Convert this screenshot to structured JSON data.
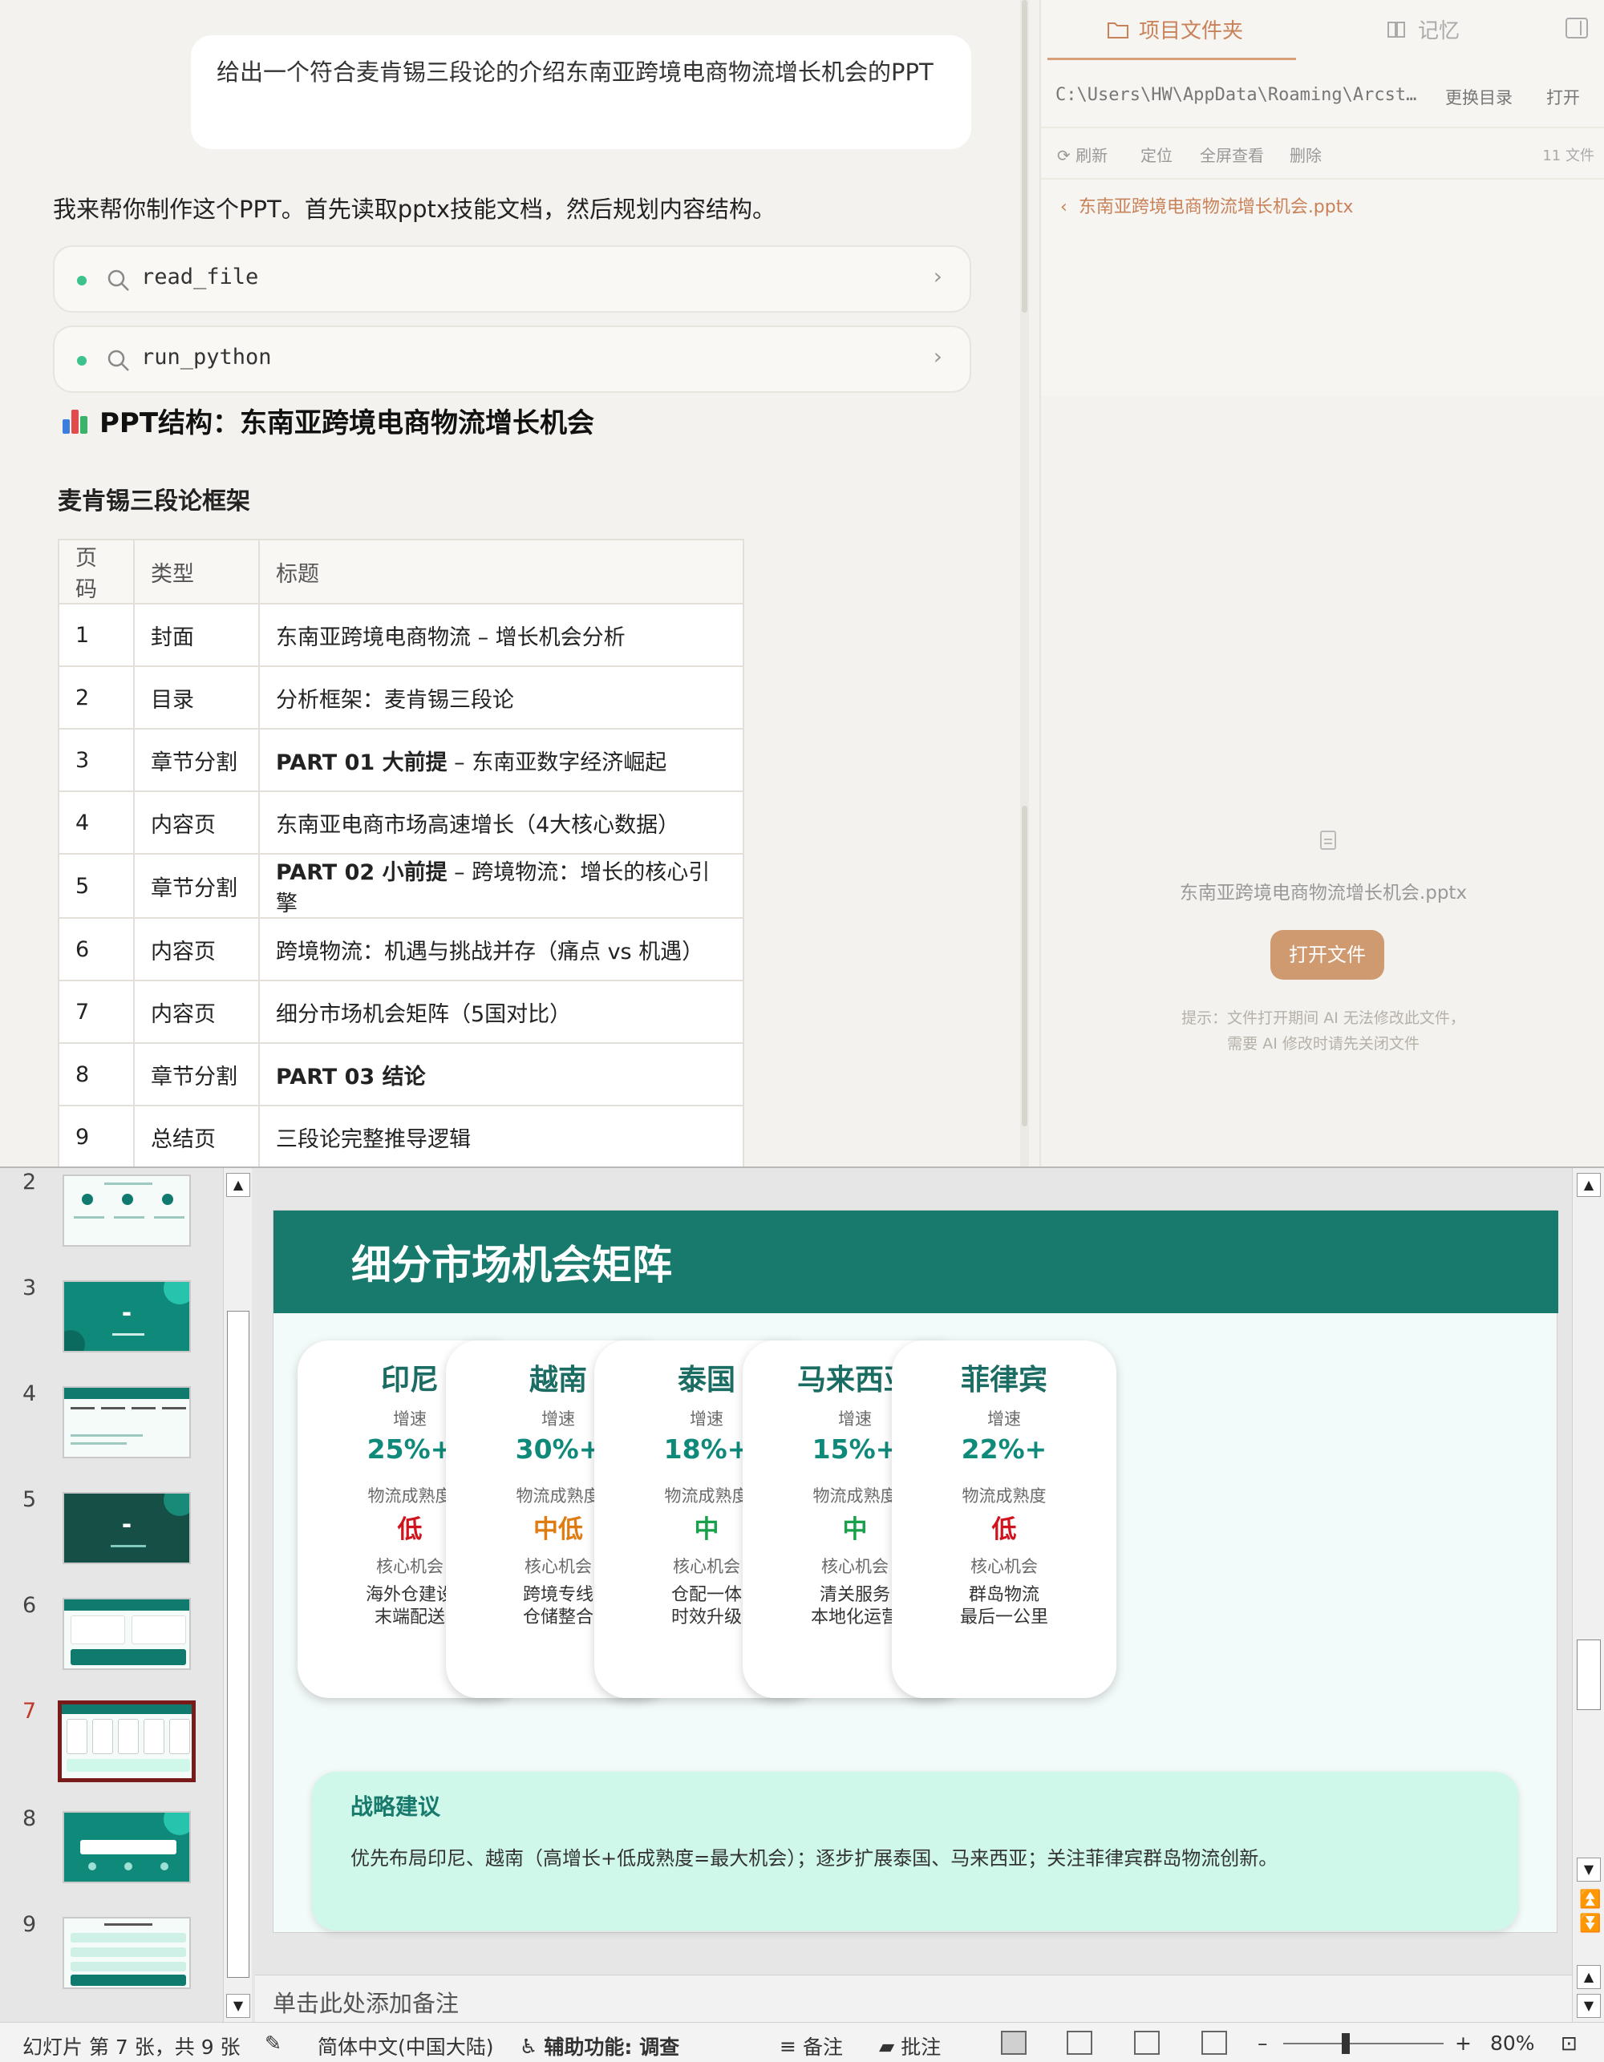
{
  "chat": {
    "user_message": "给出一个符合麦肯锡三段论的介绍东南亚跨境电商物流增长机会的PPT",
    "assistant_intro": "我来帮你制作这个PPT。首先读取pptx技能文档，然后规划内容结构。",
    "tool_calls": [
      {
        "name": "read_file",
        "status_color": "#3cc28a"
      },
      {
        "name": "run_python",
        "status_color": "#3cc28a"
      }
    ],
    "structure_heading": "PPT结构：东南亚跨境电商物流增长机会",
    "framework_heading": "麦肯锡三段论框架",
    "table": {
      "headers": [
        "页码",
        "类型",
        "标题"
      ],
      "rows": [
        {
          "page": "1",
          "type": "封面",
          "bold": "",
          "title": "东南亚跨境电商物流 – 增长机会分析"
        },
        {
          "page": "2",
          "type": "目录",
          "bold": "",
          "title": "分析框架：麦肯锡三段论"
        },
        {
          "page": "3",
          "type": "章节分割",
          "bold": "PART 01 大前提",
          "title": " – 东南亚数字经济崛起"
        },
        {
          "page": "4",
          "type": "内容页",
          "bold": "",
          "title": "东南亚电商市场高速增长（4大核心数据）"
        },
        {
          "page": "5",
          "type": "章节分割",
          "bold": "PART 02 小前提",
          "title": " – 跨境物流：增长的核心引擎"
        },
        {
          "page": "6",
          "type": "内容页",
          "bold": "",
          "title": "跨境物流：机遇与挑战并存（痛点 vs 机遇）"
        },
        {
          "page": "7",
          "type": "内容页",
          "bold": "",
          "title": "细分市场机会矩阵（5国对比）"
        },
        {
          "page": "8",
          "type": "章节分割",
          "bold": "PART 03 结论",
          "title": ""
        },
        {
          "page": "9",
          "type": "总结页",
          "bold": "",
          "title": "三段论完整推导逻辑"
        }
      ]
    }
  },
  "file_panel": {
    "tab_project": "项目文件夹",
    "tab_memory": "记忆",
    "path": "C:\\Users\\HW\\AppData\\Roaming\\Arcst…",
    "change_dir": "更换目录",
    "open": "打开",
    "actions": [
      "刷新",
      "定位",
      "全屏查看",
      "删除"
    ],
    "file_count": "11 文件",
    "breadcrumb": "东南亚跨境电商物流增长机会.pptx",
    "preview_filename": "东南亚跨境电商物流增长机会.pptx",
    "open_file_button": "打开文件",
    "hint_line1": "提示：文件打开期间 AI 无法修改此文件，",
    "hint_line2": "需要 AI 修改时请先关闭文件",
    "accent_color": "#c8825a"
  },
  "ppt": {
    "thumbnails": [
      {
        "num": "2"
      },
      {
        "num": "3"
      },
      {
        "num": "4"
      },
      {
        "num": "5"
      },
      {
        "num": "6"
      },
      {
        "num": "7",
        "selected": true
      },
      {
        "num": "8"
      },
      {
        "num": "9"
      }
    ],
    "slide": {
      "title": "细分市场机会矩阵",
      "growth_label": "增速",
      "maturity_label": "物流成熟度",
      "opportunity_label": "核心机会",
      "cards": [
        {
          "country": "印尼",
          "growth": "25%+",
          "maturity": "低",
          "maturity_color": "#d0141e",
          "opp1": "海外仓建设",
          "opp2": "末端配送"
        },
        {
          "country": "越南",
          "growth": "30%+",
          "maturity": "中低",
          "maturity_color": "#e07b10",
          "opp1": "跨境专线",
          "opp2": "仓储整合"
        },
        {
          "country": "泰国",
          "growth": "18%+",
          "maturity": "中",
          "maturity_color": "#18a14a",
          "opp1": "仓配一体",
          "opp2": "时效升级"
        },
        {
          "country": "马来西亚",
          "growth": "15%+",
          "maturity": "中",
          "maturity_color": "#18a14a",
          "opp1": "清关服务",
          "opp2": "本地化运营"
        },
        {
          "country": "菲律宾",
          "growth": "22%+",
          "maturity": "低",
          "maturity_color": "#d0141e",
          "opp1": "群岛物流",
          "opp2": "最后一公里"
        }
      ],
      "strategy_title": "战略建议",
      "strategy_body": "优先布局印尼、越南（高增长+低成熟度=最大机会）；逐步扩展泰国、马来西亚；关注菲律宾群岛物流创新。",
      "header_color": "#177a6c"
    },
    "notes_placeholder": "单击此处添加备注",
    "status": {
      "slide_info": "幻灯片 第 7 张，共 9 张",
      "language": "简体中文(中国大陆)",
      "accessibility": "辅助功能: 调查",
      "notes": "备注",
      "comments": "批注",
      "zoom": "80%"
    }
  }
}
